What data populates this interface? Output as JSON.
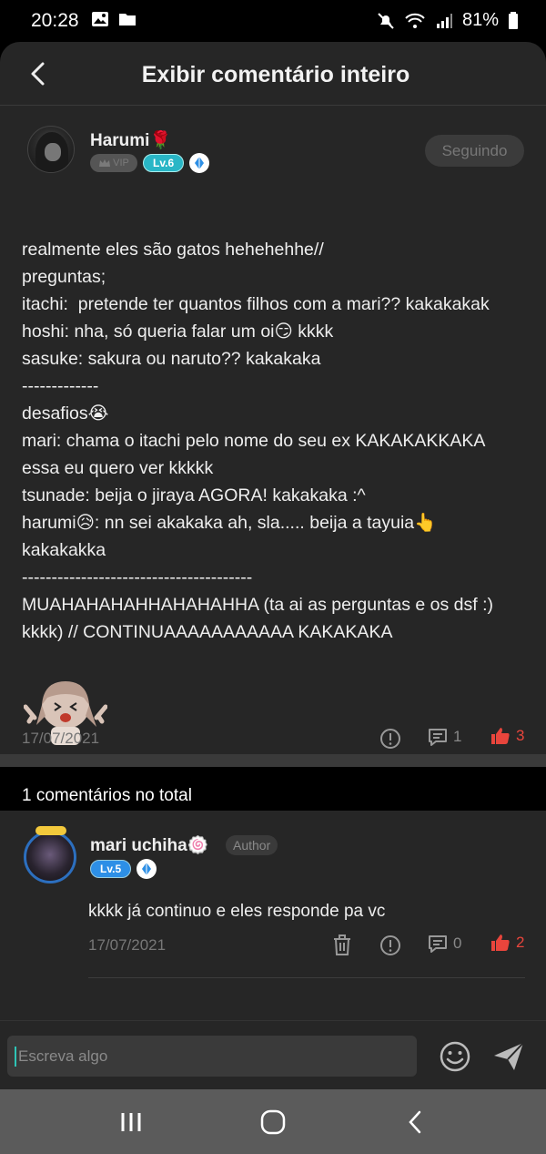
{
  "status_bar": {
    "time": "20:28",
    "battery": "81%"
  },
  "app_bar": {
    "title": "Exibir comentário inteiro"
  },
  "post": {
    "author": {
      "name": "Harumi🌹",
      "vip_label": "VIP",
      "level": "Lv.6"
    },
    "follow_label": "Seguindo",
    "lines": [
      "realmente eles são gatos hehehehhe//",
      "preguntas;",
      "itachi:  pretende ter quantos filhos com a mari?? kakakakak",
      "hoshi: nha, só queria falar um oi😏 kkkk",
      "sasuke: sakura ou naruto?? kakakaka",
      "-------------",
      "desafios😭",
      "mari: chama o itachi pelo nome do seu ex KAKAKAKKAKA",
      "essa eu quero ver kkkkk",
      "tsunade: beija o jiraya AGORA! kakakaka :^",
      "harumi😥: nn sei akakaka ah, sla..... beija a tayuia👆",
      "kakakakka",
      "---------------------------------------",
      "MUAHAHAHAHHAHAHAHHA (ta ai as perguntas e os dsf :)",
      "kkkk) // CONTINUAAAAAAAAAAA KAKAKAKA"
    ],
    "date": "17/07/2021",
    "comment_count": "1",
    "like_count": "3"
  },
  "comments_section": {
    "header": "1 comentários no total",
    "comments": [
      {
        "name": "mari uchiha🍥",
        "author_tag": "Author",
        "level": "Lv.5",
        "text": "kkkk já continuo e eles responde pa vc",
        "date": "17/07/2021",
        "comment_count": "0",
        "like_count": "2"
      }
    ]
  },
  "input": {
    "placeholder": "Escreva algo"
  },
  "colors": {
    "background": "#262626",
    "accent_like": "#e8453c",
    "level_teal": "#29b6c6",
    "level_blue": "#2d8fe6",
    "caret": "#2ec4b6"
  }
}
